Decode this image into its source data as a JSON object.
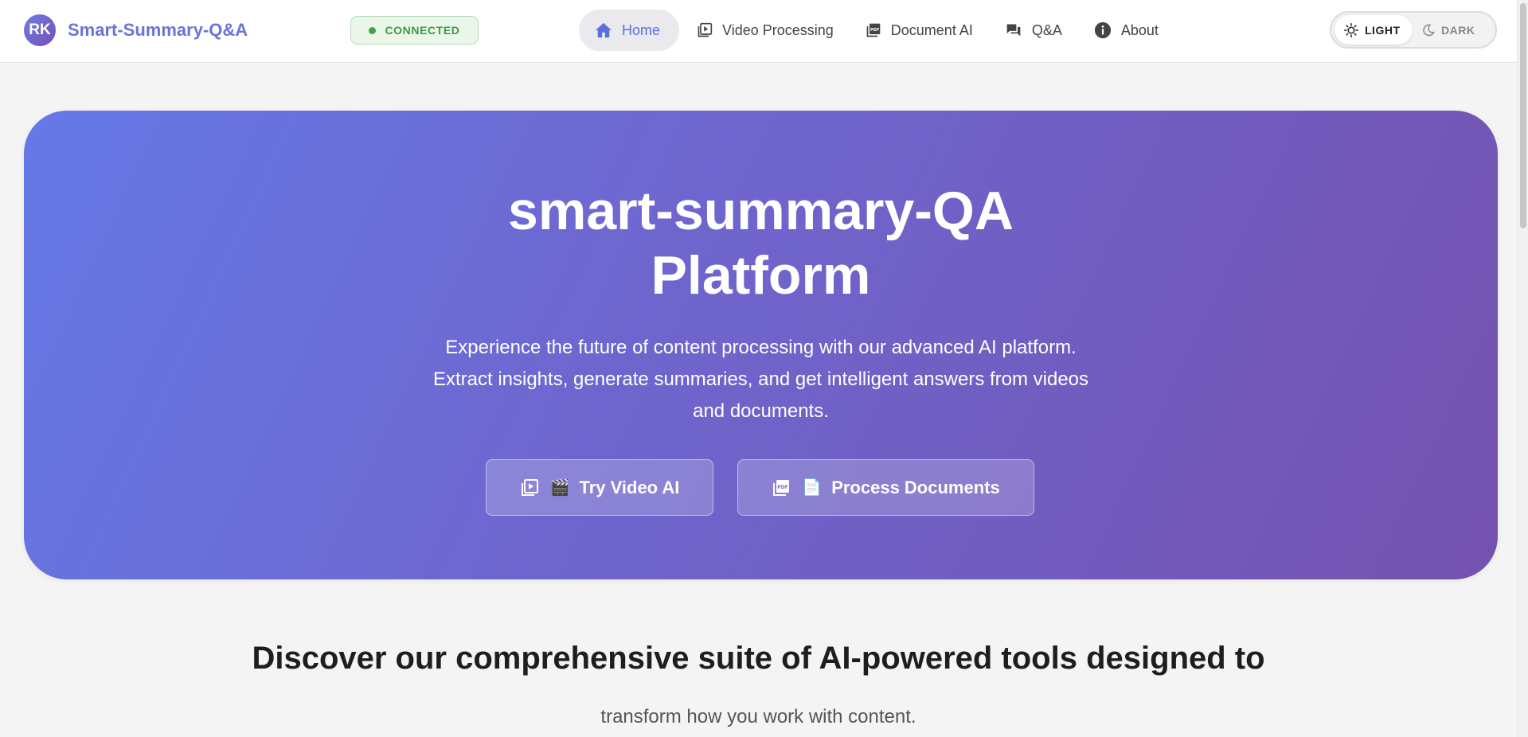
{
  "header": {
    "avatar_initials": "RK",
    "app_title": "Smart-Summary-Q&A",
    "status": "CONNECTED",
    "nav": [
      {
        "label": "Home",
        "icon": "home-icon",
        "active": true
      },
      {
        "label": "Video Processing",
        "icon": "video-library-icon",
        "active": false
      },
      {
        "label": "Document AI",
        "icon": "pdf-icon",
        "active": false
      },
      {
        "label": "Q&A",
        "icon": "chat-icon",
        "active": false
      },
      {
        "label": "About",
        "icon": "info-icon",
        "active": false
      }
    ],
    "theme": {
      "light": "LIGHT",
      "dark": "DARK",
      "selected": "LIGHT"
    }
  },
  "hero": {
    "title_line1": "smart-summary-QA",
    "title_line2": "Platform",
    "desc_line1": "Experience the future of content processing with our advanced AI platform.",
    "desc_line2": "Extract insights, generate summaries, and get intelligent answers from videos",
    "desc_line3": "and documents.",
    "btn_video_emoji": "🎬",
    "btn_video_label": "Try Video AI",
    "btn_docs_emoji": "📄",
    "btn_docs_label": "Process Documents"
  },
  "features": {
    "heading": "Discover our comprehensive suite of AI-powered tools designed to",
    "subheading": "transform how you work with content."
  },
  "colors": {
    "accent": "#6a74d8",
    "hero_start": "#6579e6",
    "hero_end": "#7452b0",
    "status_green": "#3fa548"
  }
}
